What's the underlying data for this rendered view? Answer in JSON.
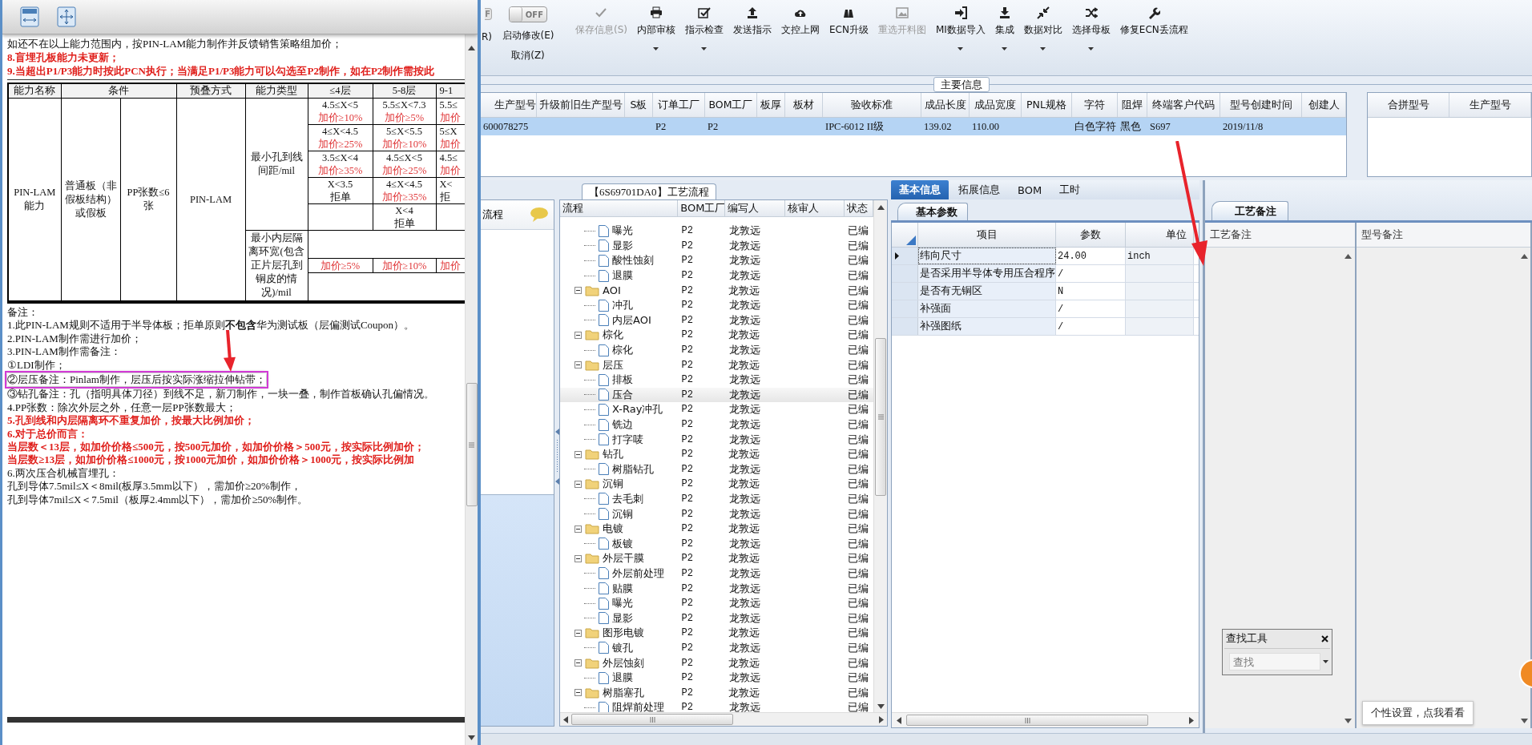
{
  "document": {
    "intro_lines": [
      {
        "text": "如还不在以上能力范围内，按PIN-LAM能力制作并反馈销售策略组加价；",
        "emphasis": false
      },
      {
        "text": "8.盲埋孔板能力未更新；",
        "emphasis": true
      },
      {
        "text": "9.当超出P1/P3能力时按此PCN执行；当满足P1/P3能力可以勾选至P2制作，如在P2制作需按此",
        "emphasis": true
      }
    ],
    "table": {
      "columns": [
        "能力名称",
        "条件",
        "预叠方式",
        "能力类型",
        "≤4层",
        "5-8层",
        "9-1"
      ],
      "name": "PIN-LAM能力",
      "condition_1": "普通板（非假板结构）或假板",
      "condition_2": "PP张数≤6张",
      "method": "PIN-LAM",
      "types": [
        {
          "label": "最小孔到线间距/mil",
          "rows": [
            [
              {
                "value": "4.5≤X<5",
                "note": "加价≥10%",
                "note_emphasis": true
              },
              {
                "value": "5.5≤X<7.3",
                "note": "加价≥5%",
                "note_emphasis": true
              },
              {
                "value": "5.5≤",
                "note": "加价",
                "note_emphasis": true
              }
            ],
            [
              {
                "value": "4≤X<4.5",
                "note": "加价≥25%",
                "note_emphasis": true
              },
              {
                "value": "5≤X<5.5",
                "note": "加价≥10%",
                "note_emphasis": true
              },
              {
                "value": "5≤X",
                "note": "加价",
                "note_emphasis": true
              }
            ],
            [
              {
                "value": "3.5≤X<4",
                "note": "加价≥35%",
                "note_emphasis": true
              },
              {
                "value": "4.5≤X<5",
                "note": "加价≥25%",
                "note_emphasis": true
              },
              {
                "value": "4.5≤",
                "note": "加价",
                "note_emphasis": true
              }
            ],
            [
              {
                "value": "X<3.5",
                "note": "拒单",
                "note_emphasis": false
              },
              {
                "value": "4≤X<4.5",
                "note": "加价≥35%",
                "note_emphasis": true
              },
              {
                "value": "X<",
                "note": "拒",
                "note_emphasis": false
              }
            ],
            [
              null,
              {
                "value": "X<4",
                "note": "拒单",
                "note_emphasis": false
              },
              null
            ]
          ]
        },
        {
          "label": "最小内层隔离环宽(包含正片层孔到铜皮的情况)/mil",
          "rows": [
            [
              null,
              null,
              null
            ],
            [
              {
                "note": "加价≥5%",
                "note_emphasis": true
              },
              {
                "note": "加价≥10%",
                "note_emphasis": true
              },
              {
                "note": "加价",
                "note_emphasis": true
              }
            ],
            [
              null,
              null,
              null
            ]
          ]
        }
      ]
    },
    "notes": [
      {
        "text": "备注：",
        "emphasis": false,
        "highlighted": false
      },
      {
        "text": "1.此PIN-LAM规则不适用于半导体板；拒单原则**不包含**华为测试板（层偏测试Coupon）。",
        "emphasis": false,
        "highlighted": false
      },
      {
        "text": "2.PIN-LAM制作需进行加价；",
        "emphasis": false,
        "highlighted": false
      },
      {
        "text": "3.PIN-LAM制作需备注：",
        "emphasis": false,
        "highlighted": false
      },
      {
        "text": "①LDI制作；",
        "emphasis": false,
        "highlighted": false
      },
      {
        "text": "②层压备注：Pinlam制作，层压后按实际涨缩拉伸钻带；",
        "emphasis": false,
        "highlighted": true
      },
      {
        "text": "③钻孔备注：孔（指明具体刀径）到线不足，新刀制作，一块一叠，制作首板确认孔偏情况。",
        "emphasis": false,
        "highlighted": false
      },
      {
        "text": "4.PP张数：除次外层之外，任意一层PP张数最大；",
        "emphasis": false,
        "highlighted": false
      },
      {
        "text": "5.孔到线和内层隔离环不重复加价，按最大比例加价；",
        "emphasis": true,
        "highlighted": false
      },
      {
        "text": "6.对于总价而言：",
        "emphasis": true,
        "highlighted": false
      },
      {
        "text": "当层数＜13层，如加价价格≤500元，按500元加价，如加价价格＞500元，按实际比例加价；",
        "emphasis": true,
        "highlighted": false
      },
      {
        "text": "当层数≥13层，如加价价格≤1000元，按1000元加价，如加价价格＞1000元，按实际比例加",
        "emphasis": true,
        "highlighted": false
      },
      {
        "text": "6.两次压合机械盲埋孔：",
        "emphasis": false,
        "highlighted": false
      },
      {
        "text": "孔到导体7.5mil≤X＜8mil(板厚3.5mm以下），需加价≥20%制作，",
        "emphasis": false,
        "highlighted": false
      },
      {
        "text": "孔到导体7mil≤X＜7.5mil（板厚2.4mm以下），需加价≥50%制作。",
        "emphasis": false,
        "highlighted": false
      }
    ]
  },
  "toolbar": {
    "cut_toggle": {
      "label": "F",
      "on": false
    },
    "cut_label": "R)",
    "toggle": {
      "label": "OFF",
      "on": false
    },
    "toggle_actions": [
      "启动修改(E)",
      "取消(Z)"
    ],
    "buttons": [
      {
        "label": "保存信息(S)",
        "disabled": true,
        "dropdown": false
      },
      {
        "label": "内部审核",
        "disabled": false,
        "dropdown": true
      },
      {
        "label": "指示检查",
        "disabled": false,
        "dropdown": true
      },
      {
        "label": "发送指示",
        "disabled": false,
        "dropdown": false
      },
      {
        "label": "文控上网",
        "disabled": false,
        "dropdown": false
      },
      {
        "label": "ECN升级",
        "disabled": false,
        "dropdown": false
      },
      {
        "label": "重选开料图",
        "disabled": true,
        "dropdown": false
      },
      {
        "label": "MI数据导入",
        "disabled": false,
        "dropdown": true
      },
      {
        "label": "集成",
        "disabled": false,
        "dropdown": true
      },
      {
        "label": "数据对比",
        "disabled": false,
        "dropdown": true
      },
      {
        "label": "选择母板",
        "disabled": false,
        "dropdown": true
      },
      {
        "label": "修复ECN丢流程",
        "disabled": false,
        "dropdown": false
      }
    ]
  },
  "main_info": {
    "title": "主要信息",
    "columns": [
      "生产型号",
      "升级前旧生产型号",
      "S板",
      "订单工厂",
      "BOM工厂",
      "板厚",
      "板材",
      "验收标准",
      "成品长度",
      "成品宽度",
      "PNL规格",
      "字符",
      "阻焊",
      "终端客户代码",
      "型号创建时间",
      "创建人"
    ],
    "rows": [
      {
        "selected": true,
        "cells": [
          "600078275",
          null,
          null,
          "P2",
          "P2",
          null,
          null,
          "IPC-6012 II级",
          "139.02",
          "110.00",
          null,
          "白色字符",
          "黑色",
          "S697",
          "2019/11/8",
          null
        ]
      }
    ],
    "side_columns": [
      "合拼型号",
      "生产型号"
    ]
  },
  "nav": {
    "label": "流程"
  },
  "flow": {
    "title": "【6S69701DA0】工艺流程",
    "columns": [
      "流程",
      "BOM工厂",
      "编写人",
      "核审人",
      "状态"
    ],
    "nodes": [
      {
        "children": [
          {
            "label": "曝光",
            "bom": "P2",
            "author": "龙敦远",
            "status": "已编",
            "selected": false
          },
          {
            "label": "显影",
            "bom": "P2",
            "author": "龙敦远",
            "status": "已编",
            "selected": false
          },
          {
            "label": "酸性蚀刻",
            "bom": "P2",
            "author": "龙敦远",
            "status": "已编",
            "selected": false
          },
          {
            "label": "退膜",
            "bom": "P2",
            "author": "龙敦远",
            "status": "已编",
            "selected": false
          }
        ]
      },
      {
        "label": "AOI",
        "bom": "P2",
        "author": "龙敦远",
        "status": "已编",
        "selected": false,
        "children": [
          {
            "label": "冲孔",
            "bom": "P2",
            "author": "龙敦远",
            "status": "已编",
            "selected": false
          },
          {
            "label": "内层AOI",
            "bom": "P2",
            "author": "龙敦远",
            "status": "已编",
            "selected": false
          }
        ]
      },
      {
        "label": "棕化",
        "bom": "P2",
        "author": "龙敦远",
        "status": "已编",
        "selected": false,
        "children": [
          {
            "label": "棕化",
            "bom": "P2",
            "author": "龙敦远",
            "status": "已编",
            "selected": false
          }
        ]
      },
      {
        "label": "层压",
        "bom": "P2",
        "author": "龙敦远",
        "status": "已编",
        "selected": false,
        "children": [
          {
            "label": "排板",
            "bom": "P2",
            "author": "龙敦远",
            "status": "已编",
            "selected": false
          },
          {
            "label": "压合",
            "bom": "P2",
            "author": "龙敦远",
            "status": "已编",
            "selected": true
          },
          {
            "label": "X-Ray冲孔",
            "bom": "P2",
            "author": "龙敦远",
            "status": "已编",
            "selected": false
          },
          {
            "label": "铣边",
            "bom": "P2",
            "author": "龙敦远",
            "status": "已编",
            "selected": false
          },
          {
            "label": "打字唛",
            "bom": "P2",
            "author": "龙敦远",
            "status": "已编",
            "selected": false
          }
        ]
      },
      {
        "label": "钻孔",
        "bom": "P2",
        "author": "龙敦远",
        "status": "已编",
        "selected": false,
        "children": [
          {
            "label": "树脂钻孔",
            "bom": "P2",
            "author": "龙敦远",
            "status": "已编",
            "selected": false
          }
        ]
      },
      {
        "label": "沉铜",
        "bom": "P2",
        "author": "龙敦远",
        "status": "已编",
        "selected": false,
        "children": [
          {
            "label": "去毛刺",
            "bom": "P2",
            "author": "龙敦远",
            "status": "已编",
            "selected": false
          },
          {
            "label": "沉铜",
            "bom": "P2",
            "author": "龙敦远",
            "status": "已编",
            "selected": false
          }
        ]
      },
      {
        "label": "电镀",
        "bom": "P2",
        "author": "龙敦远",
        "status": "已编",
        "selected": false,
        "children": [
          {
            "label": "板镀",
            "bom": "P2",
            "author": "龙敦远",
            "status": "已编",
            "selected": false
          }
        ]
      },
      {
        "label": "外层干膜",
        "bom": "P2",
        "author": "龙敦远",
        "status": "已编",
        "selected": false,
        "children": [
          {
            "label": "外层前处理",
            "bom": "P2",
            "author": "龙敦远",
            "status": "已编",
            "selected": false
          },
          {
            "label": "贴膜",
            "bom": "P2",
            "author": "龙敦远",
            "status": "已编",
            "selected": false
          },
          {
            "label": "曝光",
            "bom": "P2",
            "author": "龙敦远",
            "status": "已编",
            "selected": false
          },
          {
            "label": "显影",
            "bom": "P2",
            "author": "龙敦远",
            "status": "已编",
            "selected": false
          }
        ]
      },
      {
        "label": "图形电镀",
        "bom": "P2",
        "author": "龙敦远",
        "status": "已编",
        "selected": false,
        "children": [
          {
            "label": "镀孔",
            "bom": "P2",
            "author": "龙敦远",
            "status": "已编",
            "selected": false
          }
        ]
      },
      {
        "label": "外层蚀刻",
        "bom": "P2",
        "author": "龙敦远",
        "status": "已编",
        "selected": false,
        "children": [
          {
            "label": "退膜",
            "bom": "P2",
            "author": "龙敦远",
            "status": "已编",
            "selected": false
          }
        ]
      },
      {
        "label": "树脂塞孔",
        "bom": "P2",
        "author": "龙敦远",
        "status": "已编",
        "selected": false,
        "children": [
          {
            "label": "阻焊前处理",
            "bom": "P2",
            "author": "龙敦远",
            "status": "已编",
            "selected": false
          }
        ]
      }
    ]
  },
  "params": {
    "tabs": [
      {
        "label": "基本信息",
        "selected": true
      },
      {
        "label": "拓展信息",
        "selected": false
      },
      {
        "label": "BOM",
        "selected": false
      },
      {
        "label": "工时",
        "selected": false
      }
    ],
    "subtab": "基本参数",
    "columns": [
      "项目",
      "参数",
      "单位"
    ],
    "rows": [
      {
        "item": "纬向尺寸",
        "value": "24.00",
        "unit": "inch",
        "selected": true
      },
      {
        "item": "是否采用半导体专用压合程序",
        "value": "/",
        "selected": false
      },
      {
        "item": "是否有无铜区",
        "value": "N",
        "selected": false
      },
      {
        "item": "补强面",
        "value": "/",
        "selected": false
      },
      {
        "item": "补强图纸",
        "value": "/",
        "selected": false
      }
    ]
  },
  "remarks": {
    "tab": "工艺备注",
    "columns": [
      "工艺备注",
      "型号备注"
    ]
  },
  "find_tool": {
    "title": "查找工具",
    "placeholder": "查找"
  },
  "tooltip": "个性设置，点我看看"
}
